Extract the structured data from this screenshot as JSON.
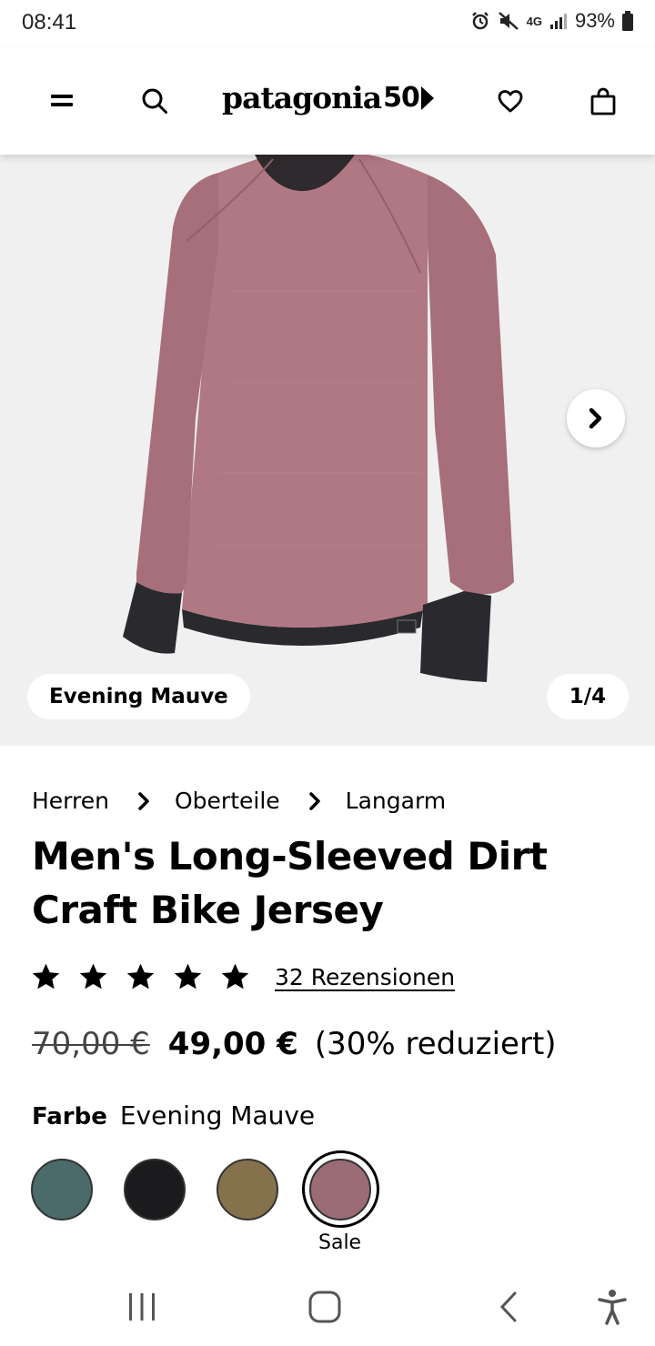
{
  "status_bar": {
    "time": "08:41",
    "network": "4G",
    "battery": "93%"
  },
  "header": {
    "logo_text": "patagonia",
    "logo_suffix": "50"
  },
  "hero": {
    "color_name": "Evening Mauve",
    "image_counter": "1/4"
  },
  "breadcrumb": [
    "Herren",
    "Oberteile",
    "Langarm"
  ],
  "product": {
    "title": "Men's Long-Sleeved Dirt Craft Bike Jersey",
    "rating_stars": 5,
    "reviews_label": "32 Rezensionen",
    "old_price": "70,00 €",
    "new_price": "49,00 €",
    "discount": "(30% reduziert)",
    "color_label": "Farbe",
    "color_value": "Evening Mauve"
  },
  "swatches": [
    {
      "color": "#4b6a6a",
      "selected": false
    },
    {
      "color": "#1b1b1d",
      "selected": false
    },
    {
      "color": "#86714d",
      "selected": false
    },
    {
      "color": "#9b6c76",
      "selected": true,
      "label": "Sale"
    }
  ],
  "colors": {
    "jersey": "#b07883",
    "cuff": "#2a2a2e",
    "hero_bg": "#f1f0f0"
  }
}
